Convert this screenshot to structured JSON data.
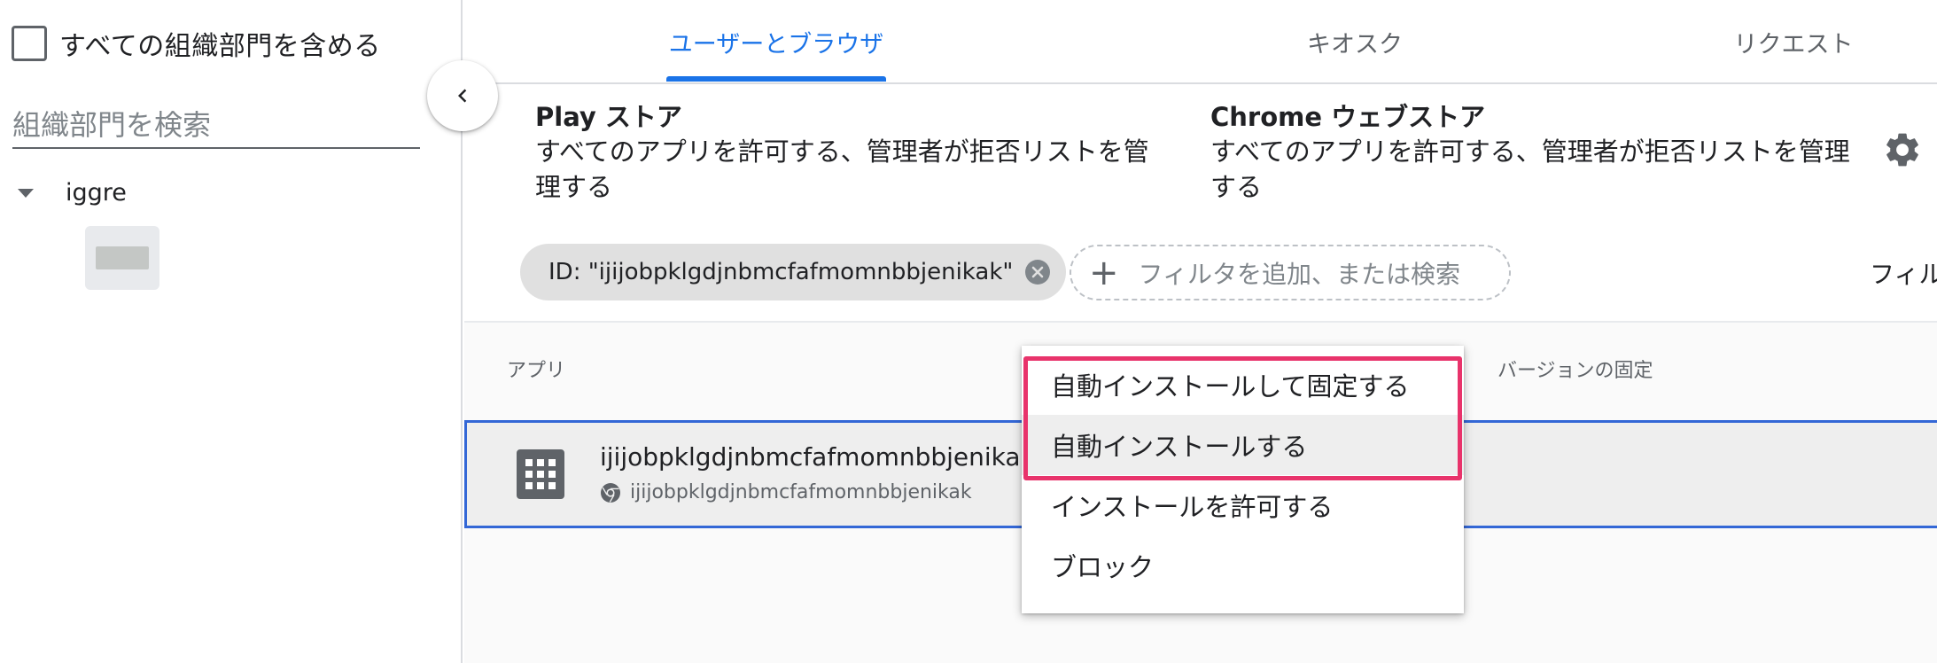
{
  "left_panel": {
    "include_all_label": "すべての組織部門を含める",
    "search_placeholder": "組織部門を検索",
    "tree_root_label": "iggre"
  },
  "tabs": [
    {
      "label": "ユーザーとブラウザ",
      "active": true
    },
    {
      "label": "キオスク",
      "active": false
    },
    {
      "label": "リクエスト",
      "active": false
    }
  ],
  "stores": [
    {
      "title": "Play ストア",
      "description": "すべてのアプリを許可する、管理者が拒否リストを管理する"
    },
    {
      "title": "Chrome ウェブストア",
      "description": "すべてのアプリを許可する、管理者が拒否リストを管理する"
    }
  ],
  "filter": {
    "chip_label": "ID: \"ijijobpklgdjnbmcfafmomnbbjenikak\"",
    "add_filter_placeholder": "フィルタを追加、または検索",
    "right_label": "フィル"
  },
  "table": {
    "col_app": "アプリ",
    "col_version": "バージョンの固定",
    "rows": [
      {
        "name": "ijijobpklgdjnbmcfafmomnbbjenikak",
        "sub": "ijijobpklgdjnbmcfafmomnbbjenikak"
      }
    ]
  },
  "menu": {
    "items": [
      {
        "label": "自動インストールして固定する"
      },
      {
        "label": "自動インストールする"
      },
      {
        "label": "インストールを許可する"
      },
      {
        "label": "ブロック"
      }
    ],
    "hovered_index": 1
  },
  "colors": {
    "accent": "#1a73e8",
    "selection_border": "#3367d6",
    "highlight_annotation": "#e8336b"
  },
  "icons": [
    "chevron-left-icon",
    "settings-gear-icon",
    "close-circle-icon",
    "plus-icon",
    "apps-grid-icon",
    "chrome-icon",
    "caret-down-icon"
  ]
}
